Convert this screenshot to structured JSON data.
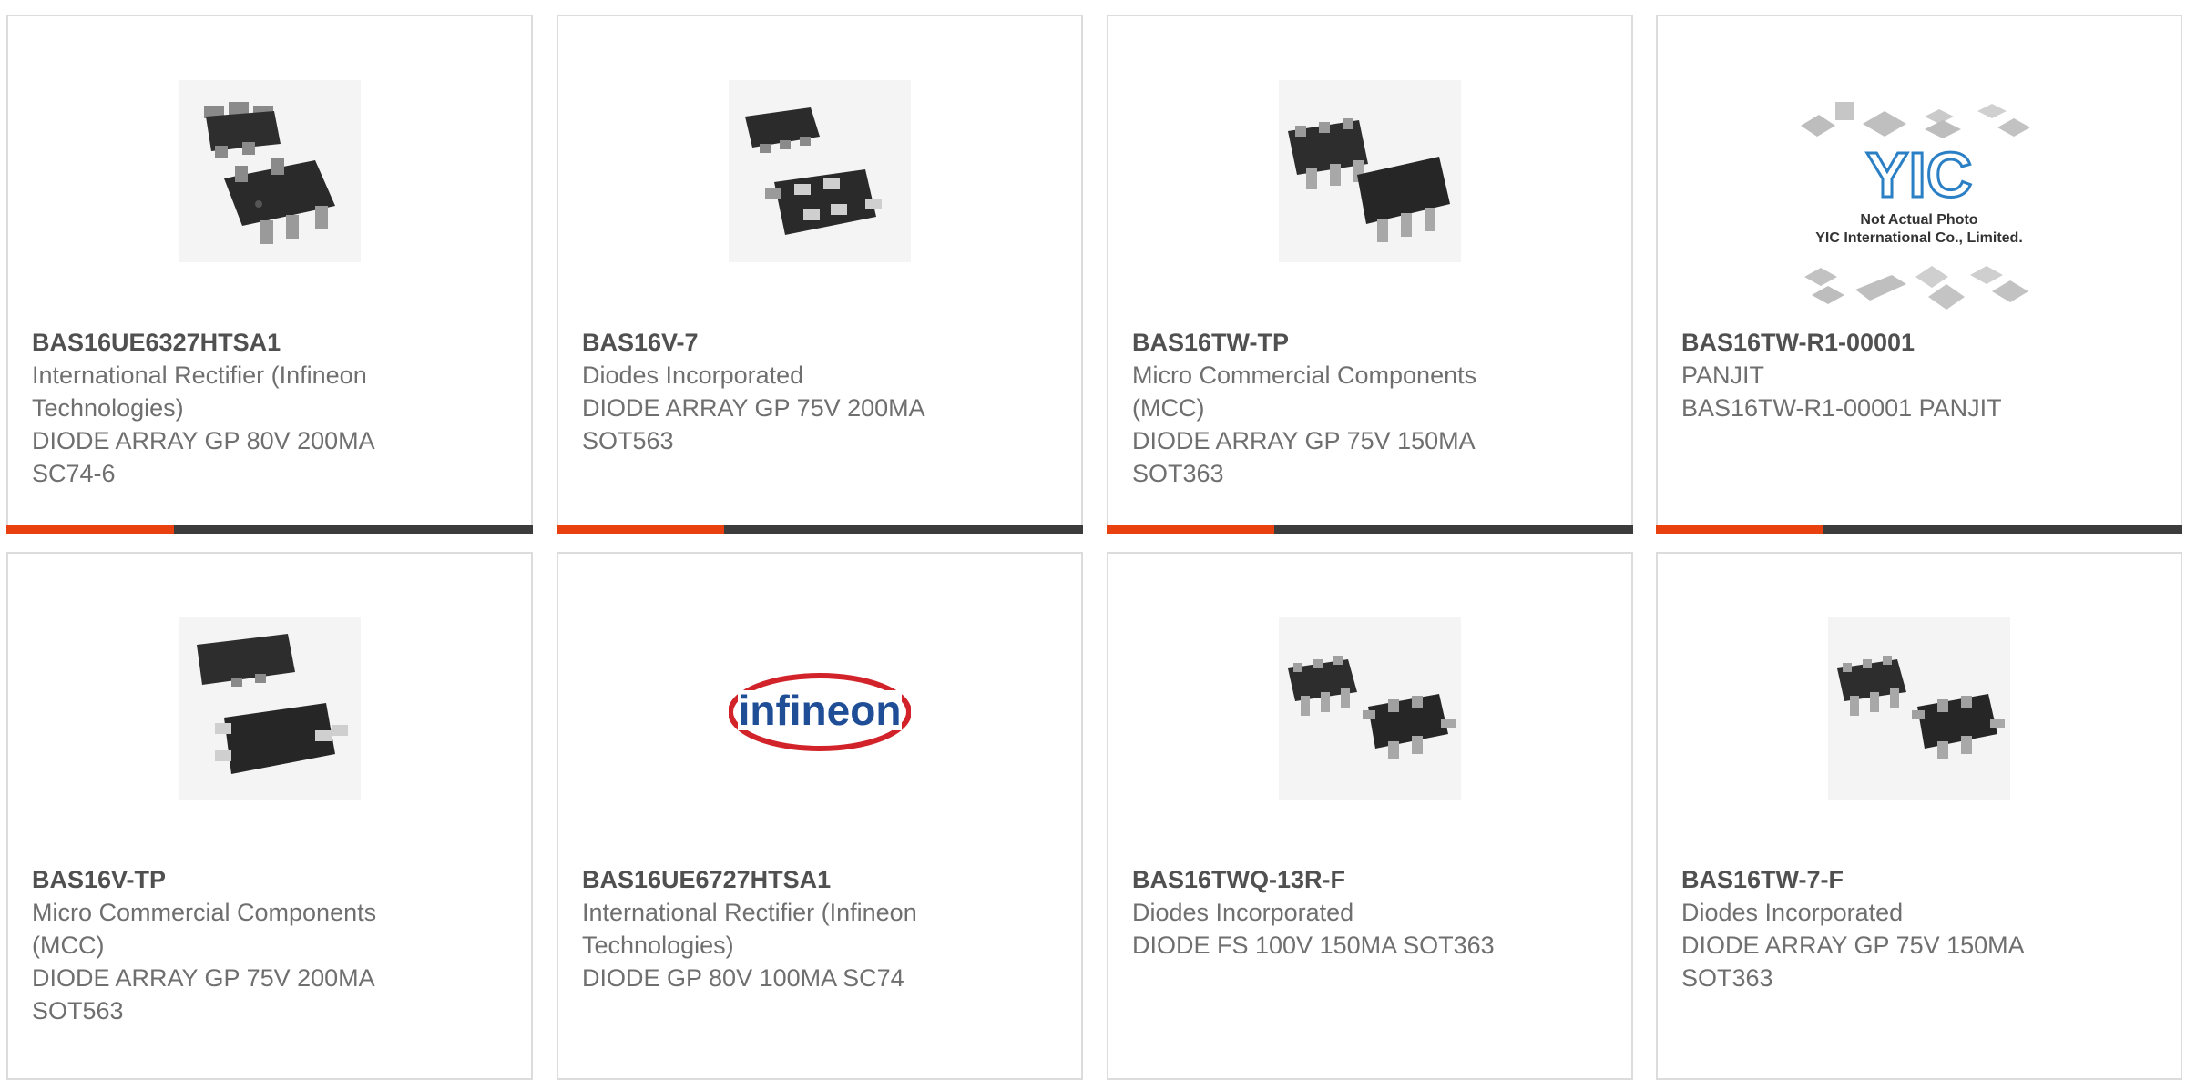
{
  "colors": {
    "accent": "#e8400f",
    "bar_dark": "#3c3c3c",
    "part_text": "#505050",
    "body_text": "#6f6f6f",
    "border": "#dcdcdc"
  },
  "products": [
    {
      "part_number": "BAS16UE6327HTSA1",
      "manufacturer": "International Rectifier (Infineon Technologies)",
      "description": "DIODE ARRAY GP 80V 200MA SC74-6",
      "image": "sc74-6-package-photo"
    },
    {
      "part_number": "BAS16V-7",
      "manufacturer": "Diodes Incorporated",
      "description": "DIODE ARRAY GP 75V 200MA SOT563",
      "image": "sot563-package-photo"
    },
    {
      "part_number": "BAS16TW-TP",
      "manufacturer": "Micro Commercial Components (MCC)",
      "description": "DIODE ARRAY GP 75V 150MA SOT363",
      "image": "sot363-package-photo"
    },
    {
      "part_number": "BAS16TW-R1-00001",
      "manufacturer": "PANJIT",
      "description": "BAS16TW-R1-00001 PANJIT",
      "image": "yic-placeholder-photo",
      "image_caption_line1": "Not Actual Photo",
      "image_caption_line2": "YIC International Co., Limited.",
      "image_logo": "YIC"
    },
    {
      "part_number": "BAS16V-TP",
      "manufacturer": "Micro Commercial Components (MCC)",
      "description": "DIODE ARRAY GP 75V 200MA SOT563",
      "image": "sot563-package-photo"
    },
    {
      "part_number": "BAS16UE6727HTSA1",
      "manufacturer": "International Rectifier (Infineon Technologies)",
      "description": "DIODE GP 80V 100MA SC74",
      "image": "infineon-logo",
      "image_logo": "infineon"
    },
    {
      "part_number": "BAS16TWQ-13R-F",
      "manufacturer": "Diodes Incorporated",
      "description": "DIODE FS 100V 150MA SOT363",
      "image": "sot363-package-photo"
    },
    {
      "part_number": "BAS16TW-7-F",
      "manufacturer": "Diodes Incorporated",
      "description": "DIODE ARRAY GP 75V 150MA SOT363",
      "image": "sot363-package-photo"
    }
  ]
}
